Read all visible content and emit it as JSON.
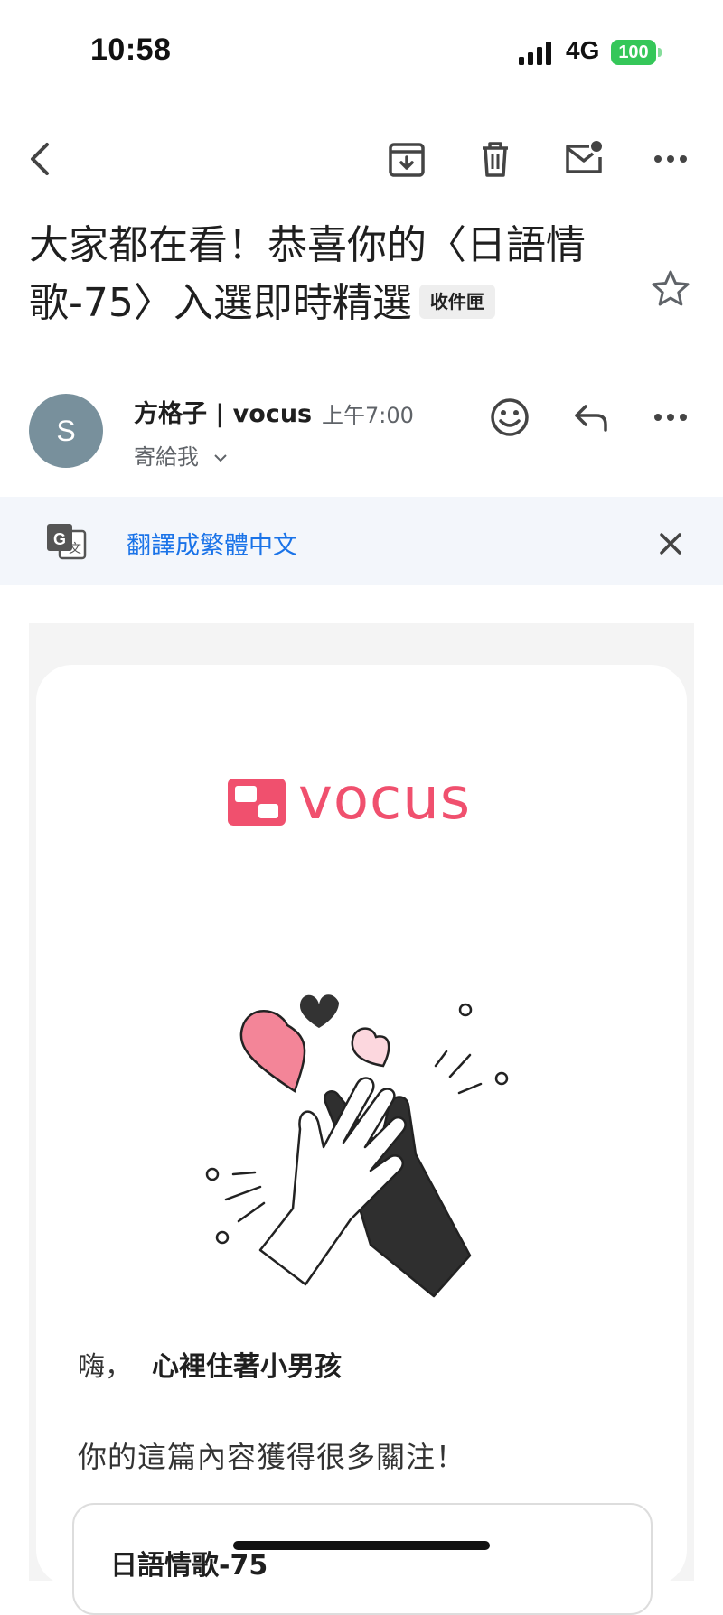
{
  "status_bar": {
    "time": "10:58",
    "network": "4G",
    "battery": "100"
  },
  "toolbar": {
    "back_icon": "chevron-left-icon",
    "archive_icon": "archive-icon",
    "delete_icon": "trash-icon",
    "mark_unread_icon": "mail-unread-icon",
    "more_icon": "more-horizontal-icon"
  },
  "email": {
    "subject": "大家都在看！恭喜你的〈日語情歌-75〉入選即時精選",
    "label": "收件匣",
    "sender_initial": "S",
    "sender_name": "方格子 | vocus",
    "time": "上午7:00",
    "recipient": "寄給我"
  },
  "translate_bar": {
    "link": "翻譯成繁體中文"
  },
  "body": {
    "brand": "vocus",
    "brand_color": "#f0506e",
    "greeting": "嗨，",
    "user_name": "心裡住著小男孩",
    "message": "你的這篇內容獲得很多關注！",
    "post_title": "日語情歌-75"
  }
}
